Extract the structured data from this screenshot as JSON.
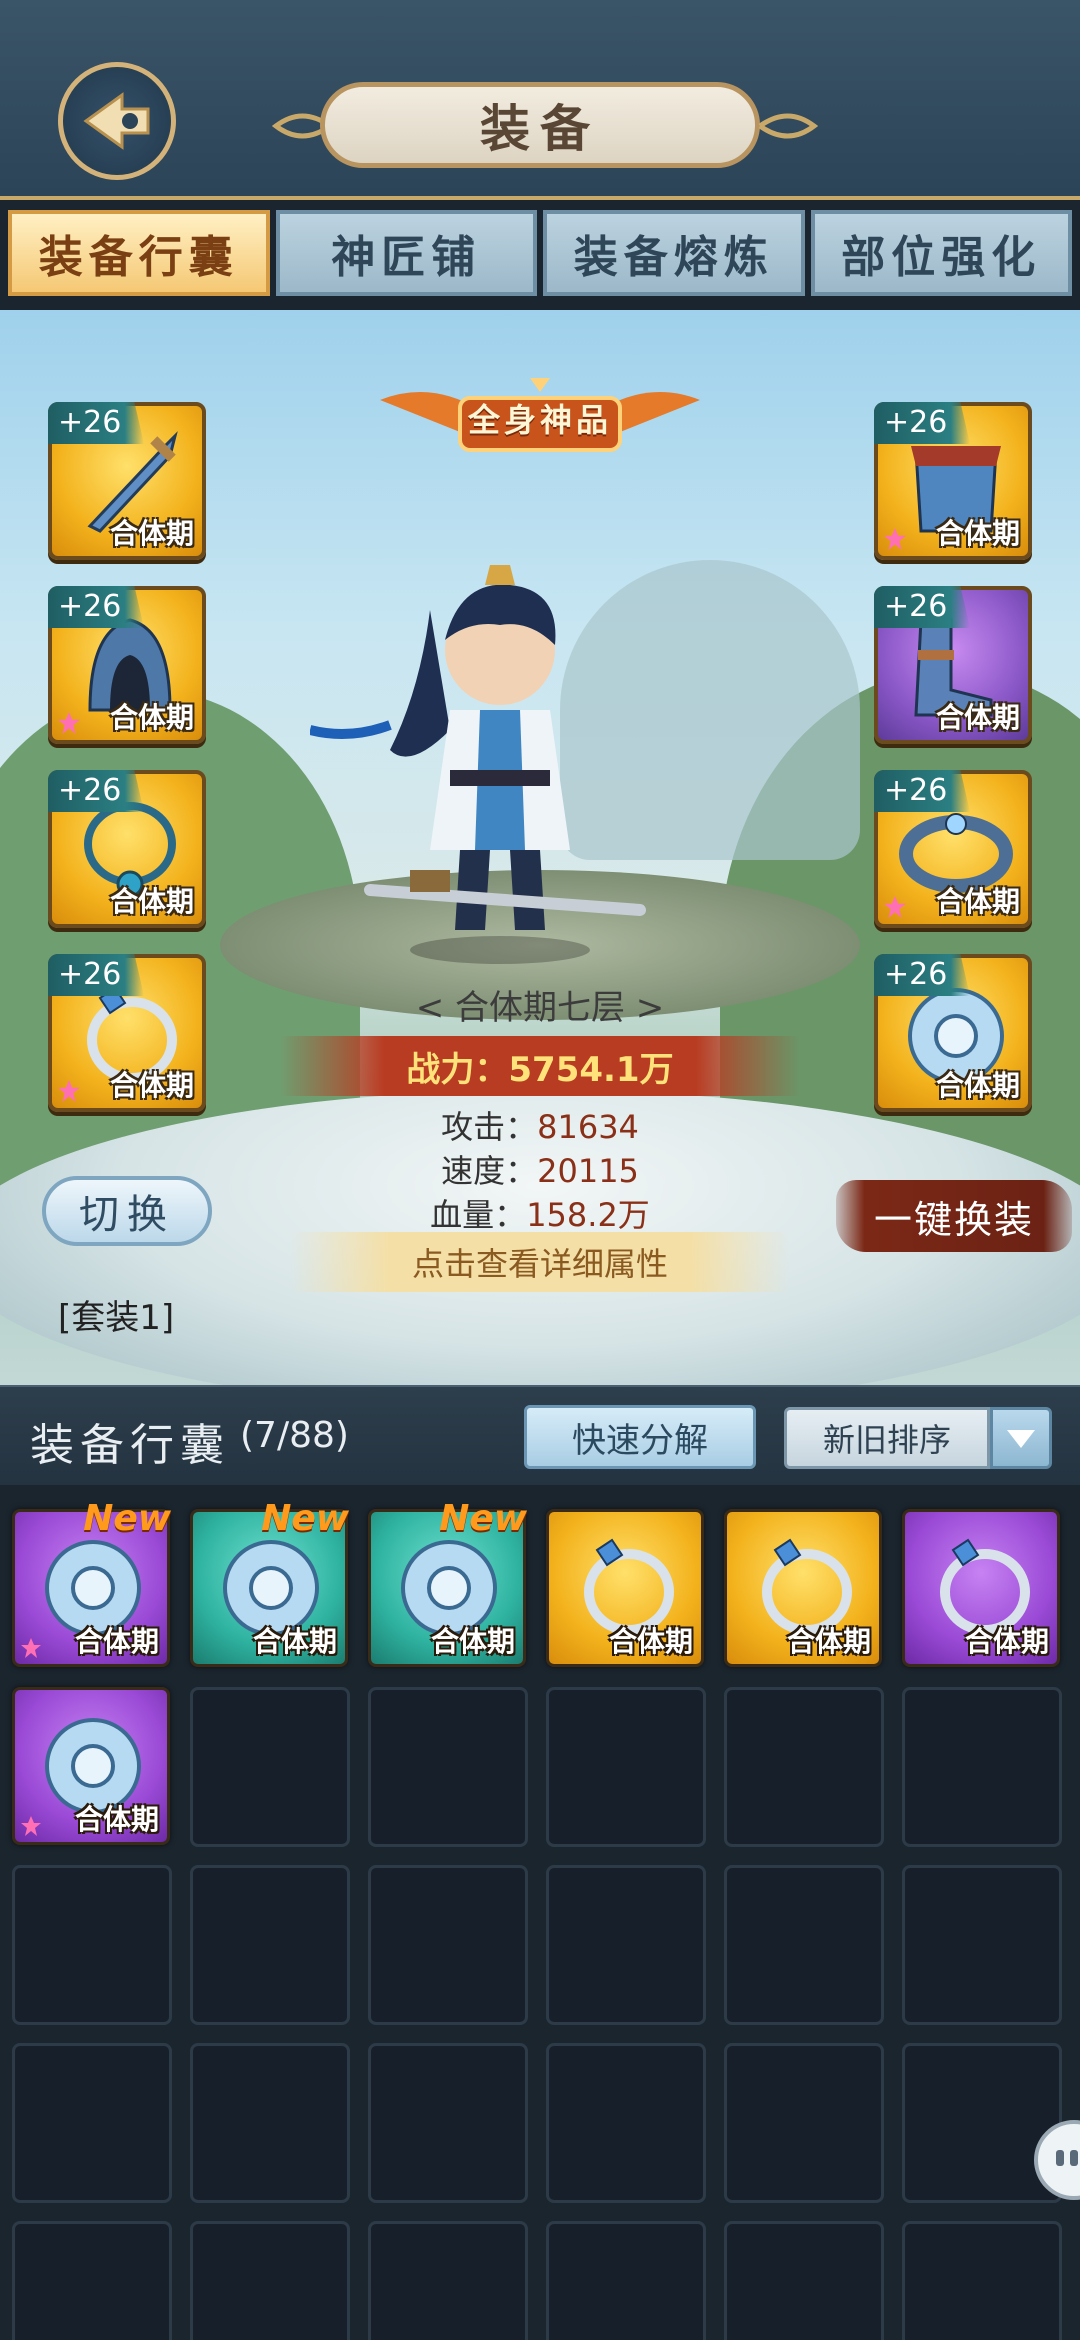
{
  "header": {
    "title": "装备"
  },
  "tabs": [
    {
      "label": "装备行囊",
      "active": true
    },
    {
      "label": "神匠铺",
      "active": false
    },
    {
      "label": "装备熔炼",
      "active": false
    },
    {
      "label": "部位强化",
      "active": false
    }
  ],
  "banner": {
    "label": "全身神品"
  },
  "equipment": {
    "left": [
      {
        "level": "+26",
        "stage": "合体期",
        "icon": "sword-icon",
        "star": false
      },
      {
        "level": "+26",
        "stage": "合体期",
        "icon": "hood-icon",
        "star": true
      },
      {
        "level": "+26",
        "stage": "合体期",
        "icon": "necklace-icon",
        "star": false
      },
      {
        "level": "+26",
        "stage": "合体期",
        "icon": "ring-icon",
        "star": true
      }
    ],
    "right": [
      {
        "level": "+26",
        "stage": "合体期",
        "icon": "armor-icon",
        "star": true
      },
      {
        "level": "+26",
        "stage": "合体期",
        "icon": "boots-icon",
        "star": false
      },
      {
        "level": "+26",
        "stage": "合体期",
        "icon": "bracelet-icon",
        "star": true
      },
      {
        "level": "+26",
        "stage": "合体期",
        "icon": "amulet-icon",
        "star": false
      }
    ]
  },
  "character": {
    "realm": "< 合体期七层 >",
    "power": "战力：5754.1万",
    "stats": [
      {
        "key": "攻击：",
        "value": "81634"
      },
      {
        "key": "速度：",
        "value": "20115"
      },
      {
        "key": "血量：",
        "value": "158.2万"
      }
    ],
    "details": "点击查看详细属性"
  },
  "actions": {
    "switch": "切换",
    "set": "[套装1]",
    "equip_all": "一键换装"
  },
  "inventory": {
    "title": "装备行囊",
    "count": "(7/88)",
    "decompose": "快速分解",
    "sort": "新旧排序",
    "items": [
      {
        "quality": "purple",
        "icon": "amulet-icon",
        "stage": "合体期",
        "new": "New",
        "star": true
      },
      {
        "quality": "teal",
        "icon": "amulet-icon",
        "stage": "合体期",
        "new": "New",
        "star": false
      },
      {
        "quality": "teal",
        "icon": "amulet-icon",
        "stage": "合体期",
        "new": "New",
        "star": false
      },
      {
        "quality": "gold",
        "icon": "ring-icon",
        "stage": "合体期",
        "new": "",
        "star": false
      },
      {
        "quality": "gold",
        "icon": "ring-icon",
        "stage": "合体期",
        "new": "",
        "star": false
      },
      {
        "quality": "purple",
        "icon": "ring-icon",
        "stage": "合体期",
        "new": "",
        "star": false
      },
      {
        "quality": "purple",
        "icon": "amulet-icon",
        "stage": "合体期",
        "new": "",
        "star": true
      }
    ],
    "total_visible_cells": 30
  }
}
